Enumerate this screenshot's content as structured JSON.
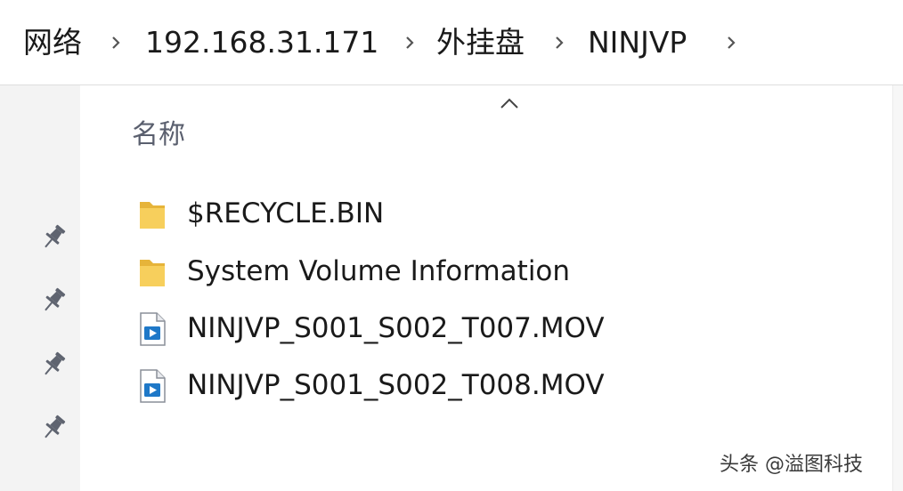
{
  "breadcrumb": {
    "items": [
      "网络",
      "192.168.31.171",
      "外挂盘",
      "NINJVP"
    ]
  },
  "file_list": {
    "column_header": "名称",
    "sort_direction": "ascending",
    "items": [
      {
        "name": "$RECYCLE.BIN",
        "type": "folder",
        "icon": "folder-icon"
      },
      {
        "name": "System Volume Information",
        "type": "folder",
        "icon": "folder-icon"
      },
      {
        "name": "NINJVP_S001_S002_T007.MOV",
        "type": "video",
        "icon": "video-file-icon"
      },
      {
        "name": "NINJVP_S001_S002_T008.MOV",
        "type": "video",
        "icon": "video-file-icon"
      }
    ]
  },
  "nav_pane": {
    "pinned_icon": "pin-icon",
    "pinned_count": 4
  },
  "watermark": {
    "text": "头条 @溢图科技"
  },
  "colors": {
    "folder": "#f0c24a",
    "video_accent": "#1e78c8",
    "header_text": "#5a5f6e",
    "nav_background": "#f3f3f3"
  }
}
